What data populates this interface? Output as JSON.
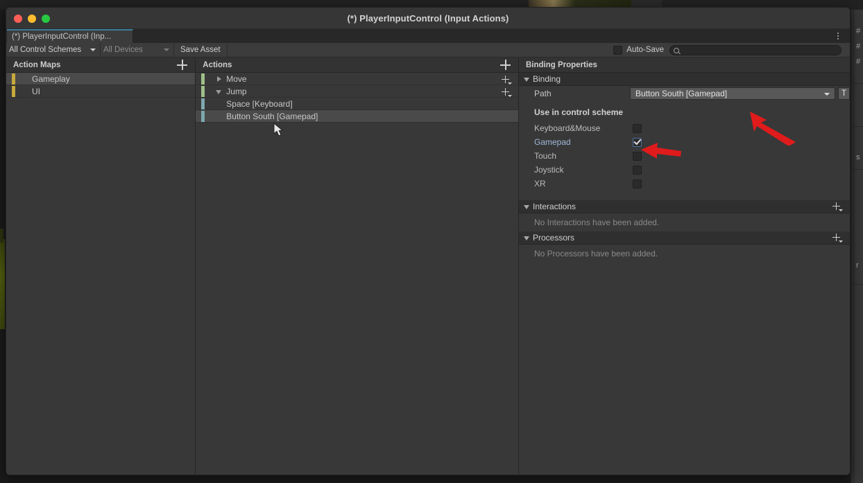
{
  "window": {
    "title": "(*) PlayerInputControl (Input Actions)",
    "tab_label": "(*) PlayerInputControl (Inp..."
  },
  "toolbar": {
    "control_schemes": "All Control Schemes",
    "devices": "All Devices",
    "save_asset": "Save Asset",
    "auto_save_label": "Auto-Save",
    "auto_save_checked": false,
    "search_value": "",
    "search_placeholder": ""
  },
  "action_maps": {
    "header": "Action Maps",
    "items": [
      {
        "label": "Gameplay",
        "selected": true
      },
      {
        "label": "UI",
        "selected": false
      }
    ]
  },
  "actions": {
    "header": "Actions",
    "items": [
      {
        "label": "Move",
        "type": "action",
        "expanded": false,
        "selected": false
      },
      {
        "label": "Jump",
        "type": "action",
        "expanded": true,
        "selected": false
      },
      {
        "label": "Space [Keyboard]",
        "type": "binding",
        "selected": false
      },
      {
        "label": "Button South [Gamepad]",
        "type": "binding",
        "selected": true
      }
    ]
  },
  "binding_properties": {
    "header": "Binding Properties",
    "binding_section": {
      "title": "Binding",
      "path_label": "Path",
      "path_value": "Button South [Gamepad]",
      "t_button": "T",
      "use_in_scheme_label": "Use in control scheme",
      "schemes": [
        {
          "name": "Keyboard&Mouse",
          "checked": false,
          "active": false
        },
        {
          "name": "Gamepad",
          "checked": true,
          "active": true
        },
        {
          "name": "Touch",
          "checked": false,
          "active": false
        },
        {
          "name": "Joystick",
          "checked": false,
          "active": false
        },
        {
          "name": "XR",
          "checked": false,
          "active": false
        }
      ]
    },
    "interactions": {
      "title": "Interactions",
      "empty_text": "No Interactions have been added."
    },
    "processors": {
      "title": "Processors",
      "empty_text": "No Processors have been added."
    }
  },
  "annotations": {
    "accent_color": "#e01b1b",
    "arrow_path_target": "path-dropdown",
    "arrow_gamepad_target": "gamepad-checkbox"
  },
  "background": {
    "right_glyphs": [
      "#",
      "#",
      "#",
      "s",
      "r"
    ]
  }
}
